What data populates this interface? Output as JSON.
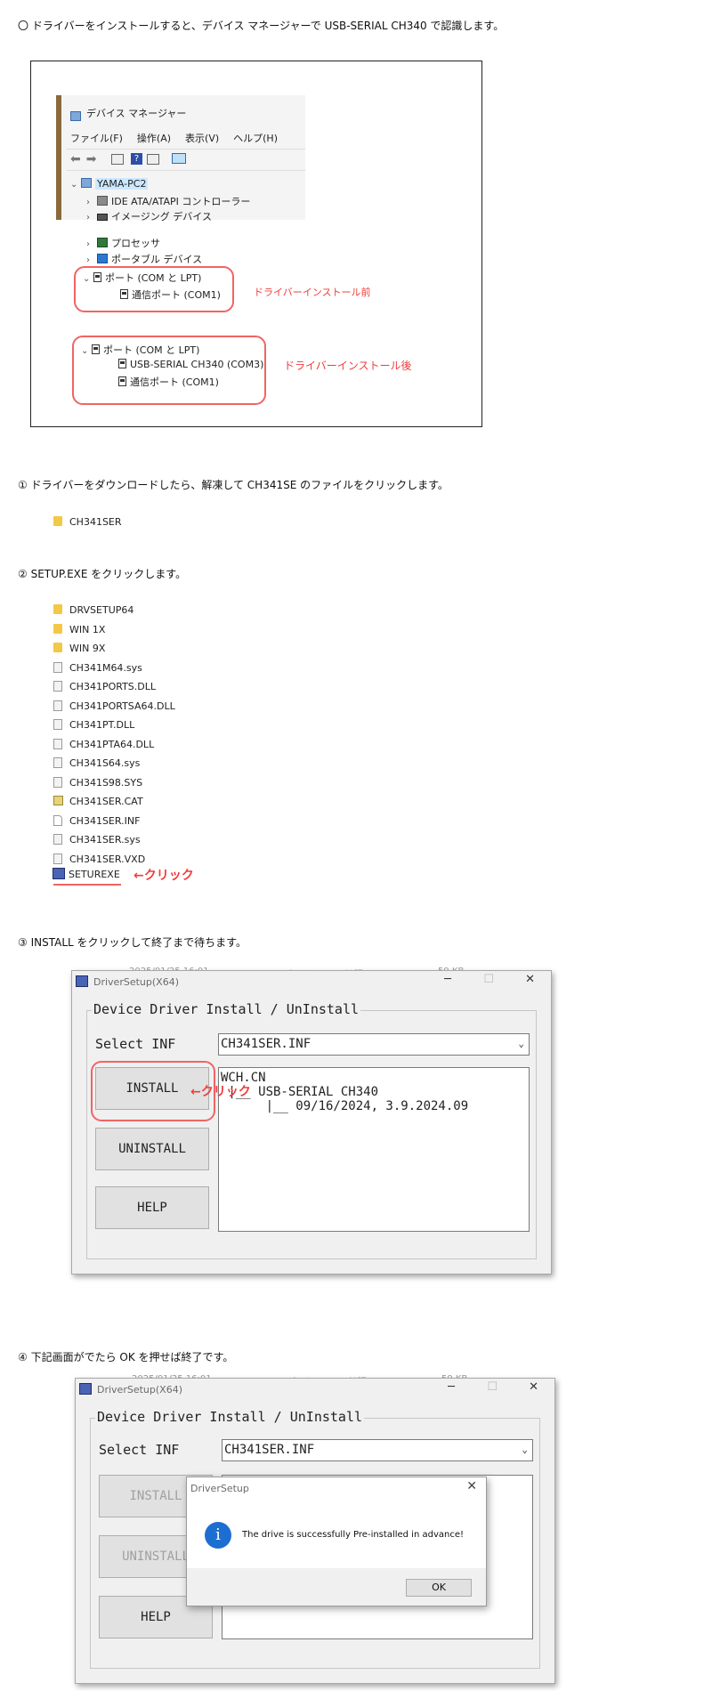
{
  "intro": "〇 ドライバーをインストールすると、デバイス マネージャーで USB-SERIAL CH340 で認識します。",
  "devmgr": {
    "title": "デバイス マネージャー",
    "menu": [
      "ファイル(F)",
      "操作(A)",
      "表示(V)",
      "ヘルプ(H)"
    ],
    "root": "YAMA-PC2",
    "nodes": [
      "IDE ATA/ATAPI コントローラー",
      "イメージング デバイス",
      "プロセッサ",
      "ポータブル デバイス"
    ],
    "before": {
      "group": "ポート (COM と LPT)",
      "items": [
        "通信ポート (COM1)"
      ],
      "note": "ドライバーインストール前"
    },
    "after": {
      "group": "ポート (COM と LPT)",
      "items": [
        "USB-SERIAL CH340 (COM3)",
        "通信ポート (COM1)"
      ],
      "note": "ドライバーインストール後"
    }
  },
  "step1": {
    "text": "① ドライバーをダウンロードしたら、解凍して CH341SE のファイルをクリックします。",
    "folder": "CH341SER"
  },
  "step2": {
    "text": "② SETUP.EXE をクリックします。",
    "files": [
      {
        "name": "DRVSETUP64",
        "type": "folder"
      },
      {
        "name": "WIN 1X",
        "type": "folder"
      },
      {
        "name": "WIN 9X",
        "type": "folder"
      },
      {
        "name": "CH341M64.sys",
        "type": "sys"
      },
      {
        "name": "CH341PORTS.DLL",
        "type": "sys"
      },
      {
        "name": "CH341PORTSA64.DLL",
        "type": "sys"
      },
      {
        "name": "CH341PT.DLL",
        "type": "sys"
      },
      {
        "name": "CH341PTA64.DLL",
        "type": "sys"
      },
      {
        "name": "CH341S64.sys",
        "type": "sys"
      },
      {
        "name": "CH341S98.SYS",
        "type": "sys"
      },
      {
        "name": "CH341SER.CAT",
        "type": "cat"
      },
      {
        "name": "CH341SER.INF",
        "type": "inf"
      },
      {
        "name": "CH341SER.sys",
        "type": "sys"
      },
      {
        "name": "CH341SER.VXD",
        "type": "sys"
      }
    ],
    "setup": "SETUREXE",
    "click_note": "←クリック"
  },
  "step3": {
    "text": "③ INSTALL をクリックして終了まで待ちます。",
    "ghost_date": "2025/01/25 16:01",
    "ghost_type": "アプリケーション拡張",
    "ghost_size": "59 KB",
    "click_note": "←クリック"
  },
  "step4": {
    "text": "④ 下記画面がでたら OK を押せば終了です。",
    "ghost_date": "2025/01/25 16:01",
    "ghost_type": "アプリケーション拡張",
    "ghost_size": "59 KB"
  },
  "dialog": {
    "title": "DriverSetup(X64)",
    "group_label": "Device Driver Install / UnInstall",
    "select_label": "Select INF",
    "select_value": "CH341SER.INF",
    "install": "INSTALL",
    "uninstall": "UNINSTALL",
    "help": "HELP",
    "info": "WCH.CN\n |__ USB-SERIAL CH340\n      |__ 09/16/2024, 3.9.2024.09",
    "btn_min": "─",
    "btn_max": "☐",
    "btn_close": "✕"
  },
  "msgbox": {
    "title": "DriverSetup",
    "message": "The drive is successfully Pre-installed in advance!",
    "ok": "OK",
    "icon": "i",
    "close": "✕"
  },
  "colors": {
    "accent_red": "#f03c3c",
    "info_blue": "#1c6fd1"
  }
}
